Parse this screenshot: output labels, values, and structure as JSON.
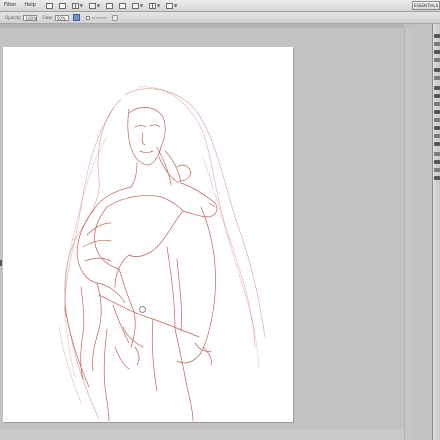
{
  "app": {
    "menus": [
      "Filter",
      "Help"
    ],
    "workspace_label": "ESSENTIALS"
  },
  "options": {
    "opacity_label": "Opacity:",
    "opacity_value": "100%",
    "flow_label": "Flow:",
    "flow_value": "50%"
  },
  "toolbar": {
    "icons": [
      "move-tool-icon",
      "marquee-tool-icon",
      "lasso-tool-icon",
      "quick-select-icon",
      "crop-tool-icon",
      "eyedropper-icon",
      "healing-brush-icon",
      "brush-tool-icon",
      "clone-stamp-icon",
      "history-brush-icon",
      "eraser-icon",
      "gradient-icon",
      "blur-icon",
      "dodge-icon",
      "pen-tool-icon",
      "type-tool-icon",
      "path-select-icon",
      "shape-tool-icon"
    ]
  },
  "canvas": {
    "stroke_color": "#b0483c",
    "subject": "sketch-woman-holding-rabbit"
  }
}
